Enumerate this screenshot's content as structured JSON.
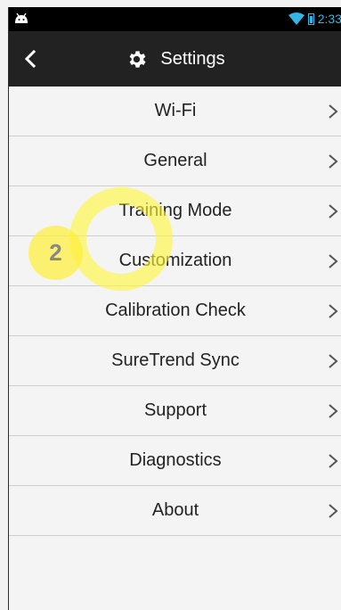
{
  "status": {
    "time": "2:33"
  },
  "header": {
    "title": "Settings"
  },
  "menu": [
    {
      "label": "Wi-Fi"
    },
    {
      "label": "General"
    },
    {
      "label": "Training Mode"
    },
    {
      "label": "Customization"
    },
    {
      "label": "Calibration Check"
    },
    {
      "label": "SureTrend Sync"
    },
    {
      "label": "Support"
    },
    {
      "label": "Diagnostics"
    },
    {
      "label": "About"
    }
  ],
  "overlay": {
    "step": "2"
  },
  "colors": {
    "status_accent": "#33b5e5",
    "highlight": "#fff03c",
    "appbar": "#222222"
  }
}
